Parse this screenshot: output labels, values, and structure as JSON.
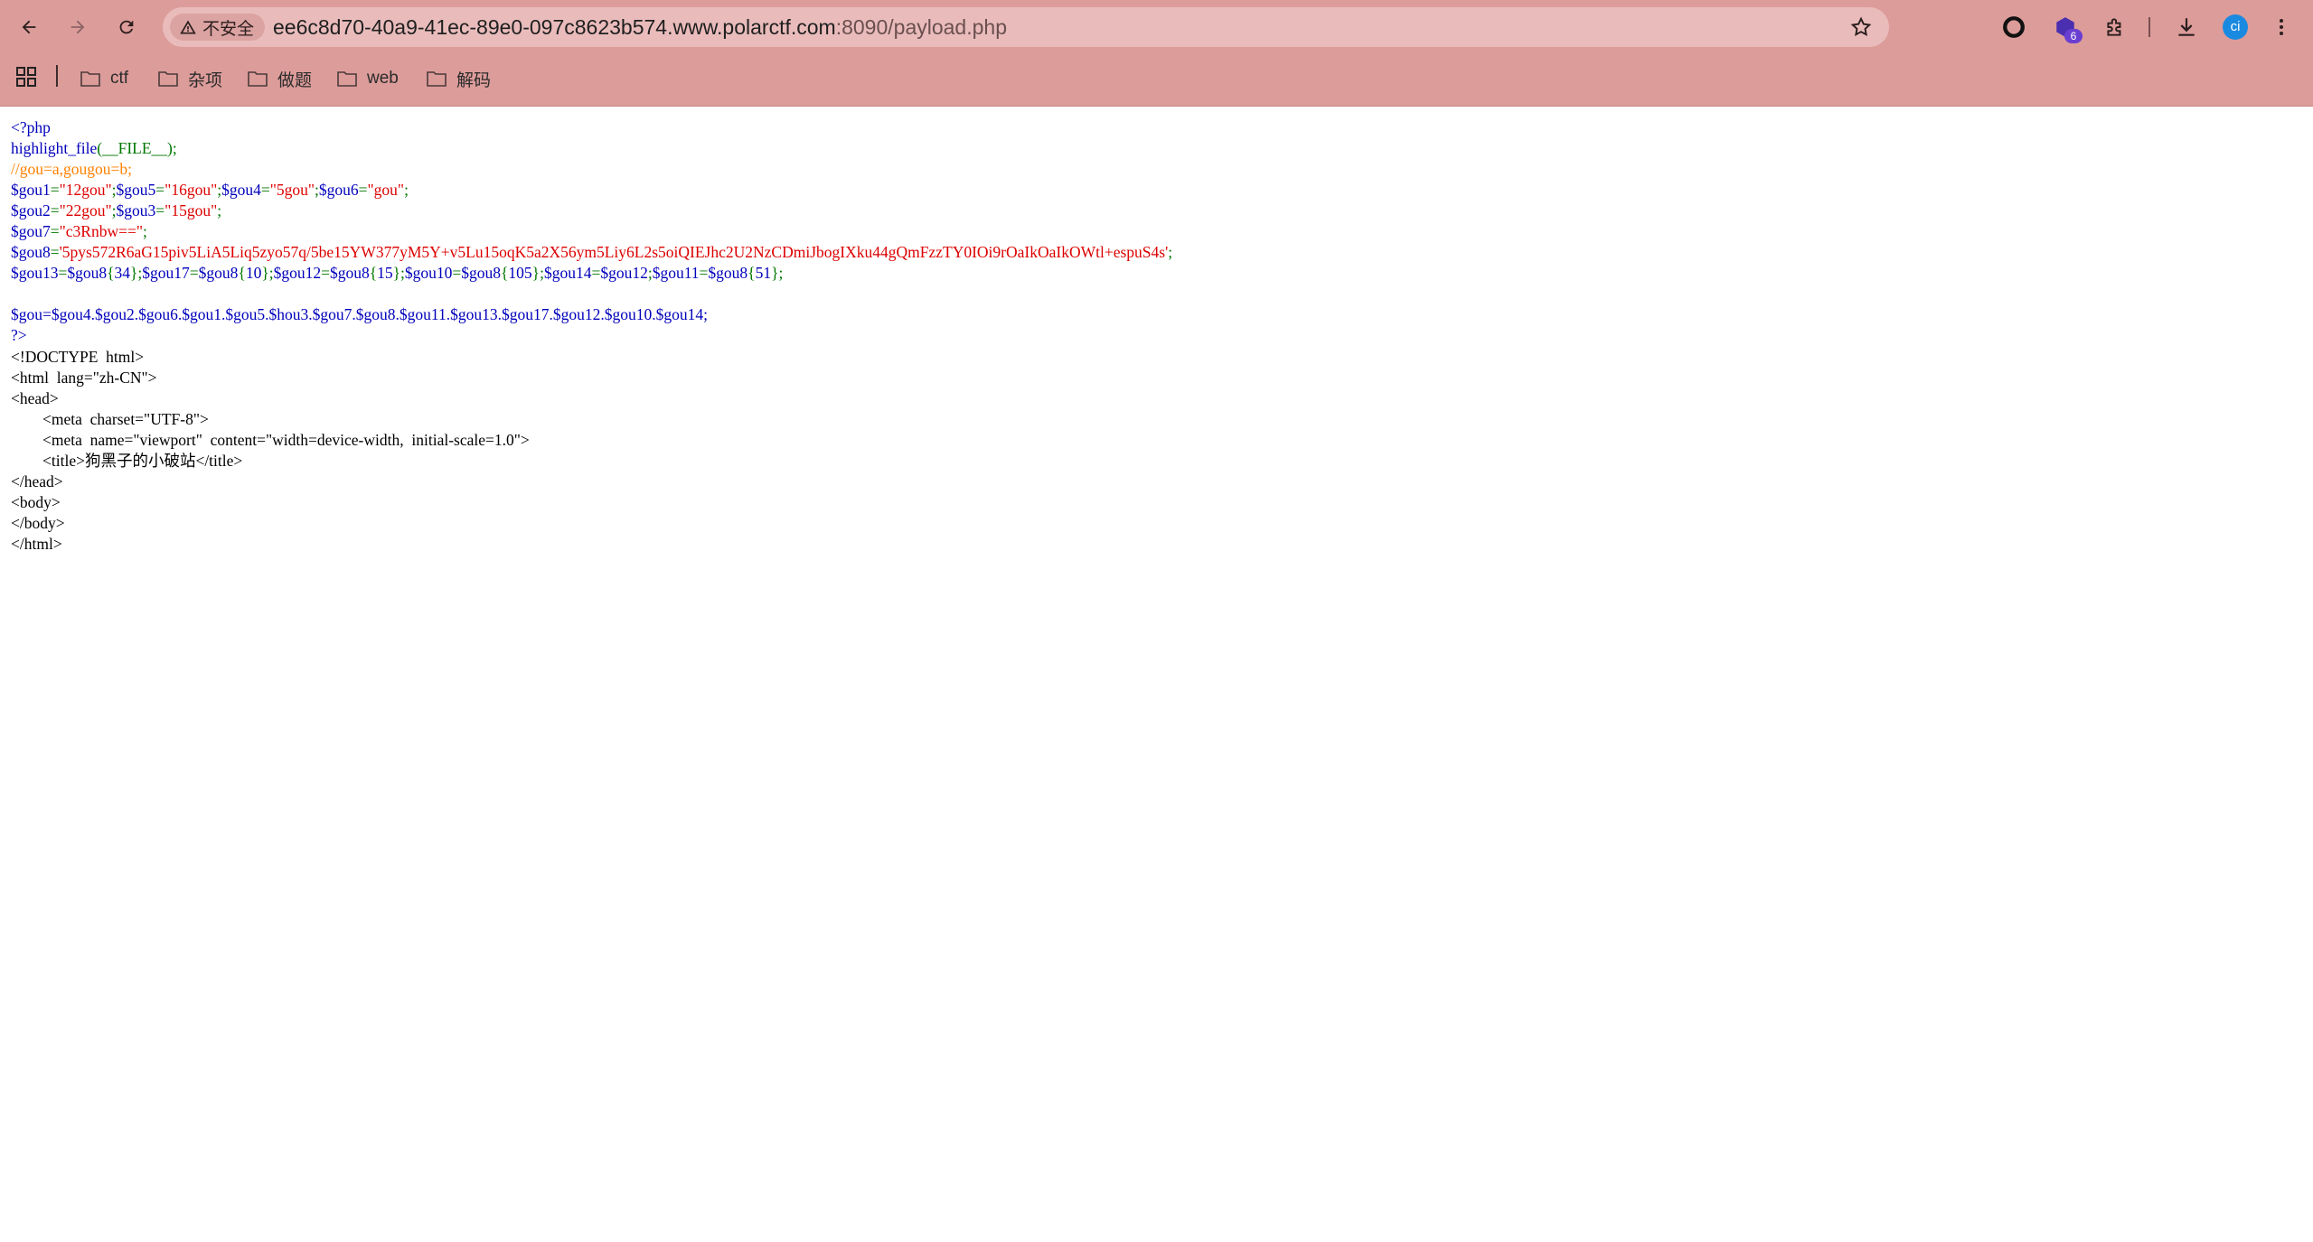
{
  "browser": {
    "security_label": "不安全",
    "url_host": "ee6c8d70-40a9-41ec-89e0-097c8623b574.www.polarctf.com",
    "url_rest": ":8090/payload.php",
    "extension_badge": "6",
    "profile_initials": "ci",
    "bookmarks": [
      "ctf",
      "杂项",
      "做题",
      "web",
      "解码"
    ]
  },
  "php_source": {
    "open_tag": "<?php",
    "line1_fn": "highlight_file",
    "line1_rest": "(__FILE__);",
    "comment": "//gou=a,gougou=b;",
    "l3": [
      {
        "v": "$gou1",
        "s": "\"12gou\""
      },
      {
        "v": "$gou5",
        "s": "\"16gou\""
      },
      {
        "v": "$gou4",
        "s": "\"5gou\""
      },
      {
        "v": "$gou6",
        "s": "\"gou\""
      }
    ],
    "l4": [
      {
        "v": "$gou2",
        "s": "\"22gou\""
      },
      {
        "v": "$gou3",
        "s": "\"15gou\""
      }
    ],
    "l5": {
      "v": "$gou7",
      "s": "\"c3Rnbw==\""
    },
    "l6": {
      "v": "$gou8",
      "s": "'5pys572R6aG15piv5LiA5Liq5zyo57q/5be15YW377yM5Y+v5Lu15oqK5a2X56ym5Liy6L2s5oiQIEJhc2U2NzCDmiJbogIXku44gQmFzzTY0IOi9rOaIkOaIkOWtl+espuS4s'"
    },
    "l7": [
      {
        "v": "$gou13",
        "e": "$gou8",
        "i": "34"
      },
      {
        "v": "$gou17",
        "e": "$gou8",
        "i": "10"
      },
      {
        "v": "$gou12",
        "e": "$gou8",
        "i": "15"
      },
      {
        "v": "$gou10",
        "e": "$gou8",
        "i": "105"
      },
      {
        "v": "$gou14",
        "e": "$gou12",
        "i": ""
      },
      {
        "v": "$gou11",
        "e": "$gou8",
        "i": "51"
      }
    ],
    "concat_line": "$gou=$gou4.$gou2.$gou6.$gou1.$gou5.$hou3.$gou7.$gou8.$gou11.$gou13.$gou17.$gou12.$gou10.$gou14;",
    "close_tag": "?>"
  },
  "html_output": {
    "lines": [
      "<!DOCTYPE  html>",
      "<html  lang=\"zh-CN\">",
      "<head>",
      "        <meta  charset=\"UTF-8\">",
      "        <meta  name=\"viewport\"  content=\"width=device-width,  initial-scale=1.0\">",
      "        <title>狗黑子的小破站</title>",
      "</head>",
      "<body>",
      "</body>",
      "</html>"
    ]
  },
  "colors": {
    "chrome": "#dc9c9a",
    "php_default": "#0000bb",
    "php_keyword": "#007700",
    "php_comment": "#ff8000",
    "php_string": "#dd0000"
  }
}
